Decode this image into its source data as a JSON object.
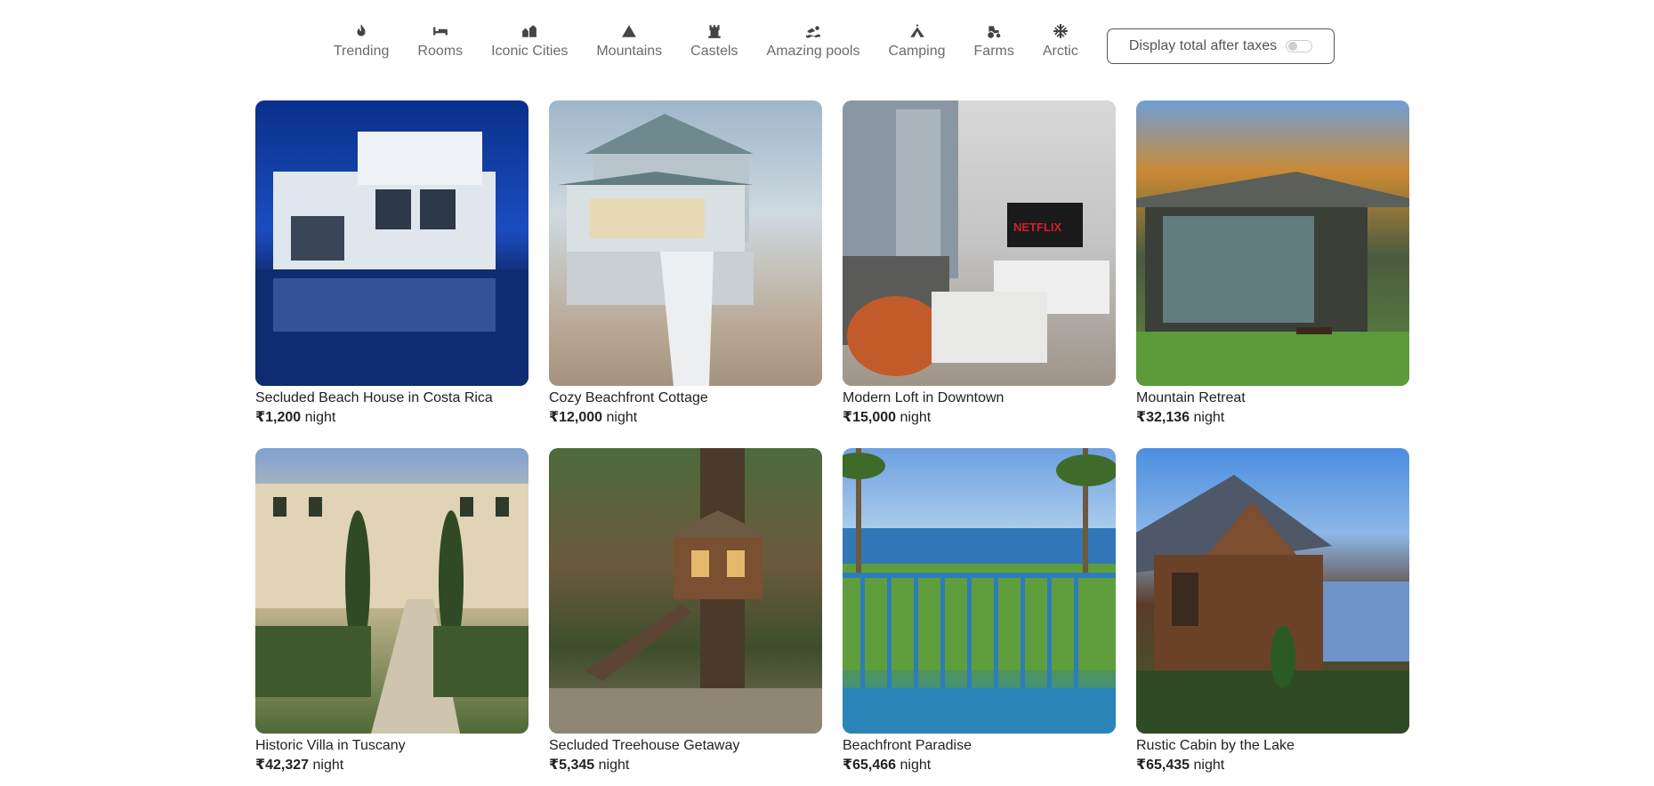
{
  "filters": [
    {
      "icon": "fire-icon",
      "label": "Trending"
    },
    {
      "icon": "bed-icon",
      "label": "Rooms"
    },
    {
      "icon": "city-icon",
      "label": "Iconic Cities"
    },
    {
      "icon": "mountain-icon",
      "label": "Mountains"
    },
    {
      "icon": "castle-icon",
      "label": "Castels"
    },
    {
      "icon": "swimmer-icon",
      "label": "Amazing pools"
    },
    {
      "icon": "tent-icon",
      "label": "Camping"
    },
    {
      "icon": "tractor-icon",
      "label": "Farms"
    },
    {
      "icon": "snowflake-icon",
      "label": "Arctic"
    }
  ],
  "tax_toggle": {
    "label": "Display total after taxes",
    "enabled": false
  },
  "listings": [
    {
      "title": "Secluded Beach House in Costa Rica",
      "price": "₹1,200",
      "unit": "night"
    },
    {
      "title": "Cozy Beachfront Cottage",
      "price": "₹12,000",
      "unit": "night"
    },
    {
      "title": "Modern Loft in Downtown",
      "price": "₹15,000",
      "unit": "night",
      "tv_text": "NETFLIX"
    },
    {
      "title": "Mountain Retreat",
      "price": "₹32,136",
      "unit": "night"
    },
    {
      "title": "Historic Villa in Tuscany",
      "price": "₹42,327",
      "unit": "night"
    },
    {
      "title": "Secluded Treehouse Getaway",
      "price": "₹5,345",
      "unit": "night"
    },
    {
      "title": "Beachfront Paradise",
      "price": "₹65,466",
      "unit": "night"
    },
    {
      "title": "Rustic Cabin by the Lake",
      "price": "₹65,435",
      "unit": "night"
    }
  ]
}
